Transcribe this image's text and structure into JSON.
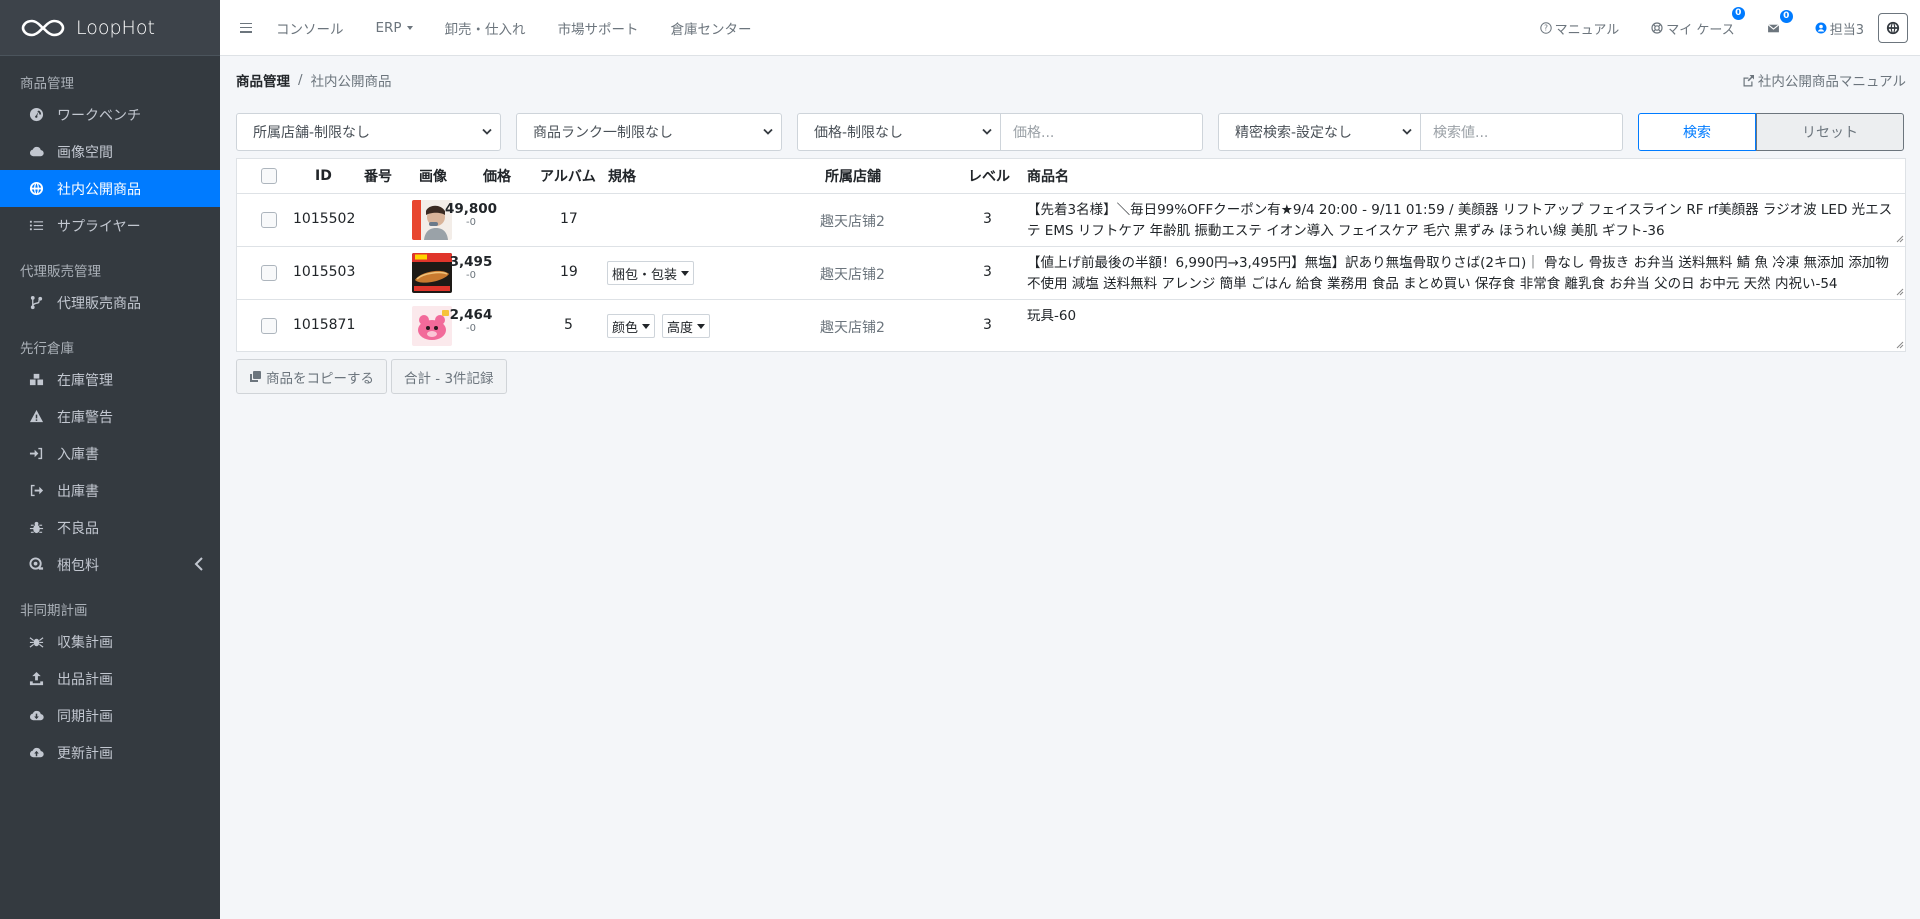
{
  "brand": {
    "name": "LoopHot"
  },
  "sidebar": {
    "sections": [
      {
        "header": "商品管理",
        "items": [
          {
            "label": "ワークベンチ",
            "icon": "gauge-icon",
            "active": false
          },
          {
            "label": "画像空間",
            "icon": "cloud-icon",
            "active": false
          },
          {
            "label": "社内公開商品",
            "icon": "globe-icon",
            "active": true
          },
          {
            "label": "サプライヤー",
            "icon": "list-icon",
            "active": false
          }
        ]
      },
      {
        "header": "代理販売管理",
        "items": [
          {
            "label": "代理販売商品",
            "icon": "code-branch-icon",
            "active": false
          }
        ]
      },
      {
        "header": "先行倉庫",
        "items": [
          {
            "label": "在庫管理",
            "icon": "cubes-icon",
            "active": false
          },
          {
            "label": "在庫警告",
            "icon": "warning-icon",
            "active": false
          },
          {
            "label": "入庫書",
            "icon": "sign-in-icon",
            "active": false
          },
          {
            "label": "出庫書",
            "icon": "sign-out-icon",
            "active": false
          },
          {
            "label": "不良品",
            "icon": "bug-icon",
            "active": false
          },
          {
            "label": "梱包料",
            "icon": "package-icon",
            "active": false
          }
        ]
      },
      {
        "header": "非同期計画",
        "items": [
          {
            "label": "収集計画",
            "icon": "spider-icon",
            "active": false
          },
          {
            "label": "出品計画",
            "icon": "upload-icon",
            "active": false
          },
          {
            "label": "同期計画",
            "icon": "cloud-download-icon",
            "active": false
          },
          {
            "label": "更新計画",
            "icon": "cloud-upload-icon",
            "active": false
          }
        ]
      }
    ]
  },
  "topnav": {
    "items": [
      "コンソール",
      "ERP",
      "卸売・仕入れ",
      "市場サポート",
      "倉庫センター"
    ]
  },
  "topright": {
    "manual": "マニュアル",
    "mycase": "マイ ケース",
    "mycase_badge": "0",
    "mail_badge": "0",
    "user": "担当3"
  },
  "breadcrumb": {
    "parent": "商品管理",
    "current": "社内公開商品",
    "manual_link": "社内公開商品マニュアル"
  },
  "filters": {
    "store": "所属店舗-制限なし",
    "rank": "商品ランク一制限なし",
    "price": "価格-制限なし",
    "price_placeholder": "価格...",
    "precise": "精密検索-設定なし",
    "search_placeholder": "検索値...",
    "search_btn": "検索",
    "reset_btn": "リセット"
  },
  "table": {
    "headers": {
      "id": "ID",
      "num": "番号",
      "image": "画像",
      "price": "価格",
      "album": "アルバム",
      "spec": "規格",
      "shop": "所属店舗",
      "level": "レベル",
      "name": "商品名"
    },
    "rows": [
      {
        "id": "1015502",
        "price": "49,800",
        "price_sub": "-0",
        "album": "17",
        "specs": [],
        "shop": "趣天店铺2",
        "level": "3",
        "name": "【先着3名様】＼毎日99%OFFクーポン有★9/4 20:00 - 9/11 01:59 /  美顔器 リフトアップ フェイスライン RF rf美顔器 ラジオ波 LED 光エステ EMS リフトケア 年齢肌 振動エステ イオン導入 フェイスケア 毛穴 黒ずみ ほうれい線 美肌 ギフト-36"
      },
      {
        "id": "1015503",
        "price": "3,495",
        "price_sub": "-0",
        "album": "19",
        "specs": [
          "梱包・包装"
        ],
        "shop": "趣天店铺2",
        "level": "3",
        "name": "【値上げ前最後の半額！6,990円→3,495円】無塩】訳あり無塩骨取りさば(2キロ)｜ 骨なし 骨抜き お弁当 送料無料 鯖 魚 冷凍 無添加 添加物不使用 減塩 送料無料 アレンジ 簡単 ごはん 給食 業務用 食品 まとめ買い 保存食 非常食 離乳食 お弁当 父の日 お中元 天然 内祝い-54"
      },
      {
        "id": "1015871",
        "price": "2,464",
        "price_sub": "-0",
        "album": "5",
        "specs": [
          "颜色",
          "高度"
        ],
        "shop": "趣天店铺2",
        "level": "3",
        "name": "玩具-60"
      }
    ]
  },
  "footer": {
    "copy_btn": "商品をコピーする",
    "total": "合計 - 3件記録"
  },
  "colors": {
    "sidebar_bg": "#343a40",
    "active": "#007bff",
    "page_bg": "#f4f6f9"
  }
}
